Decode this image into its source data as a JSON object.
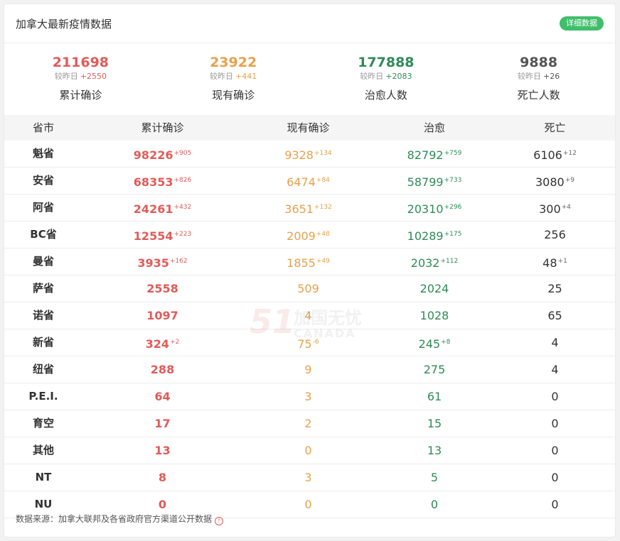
{
  "header": {
    "title": "加拿大最新疫情数据",
    "detail_button": "详细数据"
  },
  "summary": [
    {
      "value": "211698",
      "delta_label": "较昨日",
      "delta": "+2550",
      "label": "累计确诊",
      "color": "#e15b58"
    },
    {
      "value": "23922",
      "delta_label": "较昨日",
      "delta": "+441",
      "label": "现有确诊",
      "color": "#e9a04b"
    },
    {
      "value": "177888",
      "delta_label": "较昨日",
      "delta": "+2083",
      "label": "治愈人数",
      "color": "#2e8b57"
    },
    {
      "value": "9888",
      "delta_label": "较昨日",
      "delta": "+26",
      "label": "死亡人数",
      "color": "#555555"
    }
  ],
  "table": {
    "headers": {
      "province": "省市",
      "cumulative": "累计确诊",
      "active": "现有确诊",
      "recovered": "治愈",
      "deaths": "死亡"
    },
    "rows": [
      {
        "province": "魁省",
        "cumulative": "98226",
        "cumulative_inc": "+905",
        "active": "9328",
        "active_inc": "+134",
        "recovered": "82792",
        "recovered_inc": "+759",
        "deaths": "6106",
        "deaths_inc": "+12"
      },
      {
        "province": "安省",
        "cumulative": "68353",
        "cumulative_inc": "+826",
        "active": "6474",
        "active_inc": "+84",
        "recovered": "58799",
        "recovered_inc": "+733",
        "deaths": "3080",
        "deaths_inc": "+9"
      },
      {
        "province": "阿省",
        "cumulative": "24261",
        "cumulative_inc": "+432",
        "active": "3651",
        "active_inc": "+132",
        "recovered": "20310",
        "recovered_inc": "+296",
        "deaths": "300",
        "deaths_inc": "+4"
      },
      {
        "province": "BC省",
        "cumulative": "12554",
        "cumulative_inc": "+223",
        "active": "2009",
        "active_inc": "+48",
        "recovered": "10289",
        "recovered_inc": "+175",
        "deaths": "256",
        "deaths_inc": ""
      },
      {
        "province": "曼省",
        "cumulative": "3935",
        "cumulative_inc": "+162",
        "active": "1855",
        "active_inc": "+49",
        "recovered": "2032",
        "recovered_inc": "+112",
        "deaths": "48",
        "deaths_inc": "+1"
      },
      {
        "province": "萨省",
        "cumulative": "2558",
        "cumulative_inc": "",
        "active": "509",
        "active_inc": "",
        "recovered": "2024",
        "recovered_inc": "",
        "deaths": "25",
        "deaths_inc": ""
      },
      {
        "province": "诺省",
        "cumulative": "1097",
        "cumulative_inc": "",
        "active": "4",
        "active_inc": "",
        "recovered": "1028",
        "recovered_inc": "",
        "deaths": "65",
        "deaths_inc": ""
      },
      {
        "province": "新省",
        "cumulative": "324",
        "cumulative_inc": "+2",
        "active": "75",
        "active_inc": "-6",
        "recovered": "245",
        "recovered_inc": "+8",
        "deaths": "4",
        "deaths_inc": ""
      },
      {
        "province": "纽省",
        "cumulative": "288",
        "cumulative_inc": "",
        "active": "9",
        "active_inc": "",
        "recovered": "275",
        "recovered_inc": "",
        "deaths": "4",
        "deaths_inc": ""
      },
      {
        "province": "P.E.I.",
        "cumulative": "64",
        "cumulative_inc": "",
        "active": "3",
        "active_inc": "",
        "recovered": "61",
        "recovered_inc": "",
        "deaths": "0",
        "deaths_inc": ""
      },
      {
        "province": "育空",
        "cumulative": "17",
        "cumulative_inc": "",
        "active": "2",
        "active_inc": "",
        "recovered": "15",
        "recovered_inc": "",
        "deaths": "0",
        "deaths_inc": ""
      },
      {
        "province": "其他",
        "cumulative": "13",
        "cumulative_inc": "",
        "active": "0",
        "active_inc": "",
        "recovered": "13",
        "recovered_inc": "",
        "deaths": "0",
        "deaths_inc": ""
      },
      {
        "province": "NT",
        "cumulative": "8",
        "cumulative_inc": "",
        "active": "3",
        "active_inc": "",
        "recovered": "5",
        "recovered_inc": "",
        "deaths": "0",
        "deaths_inc": ""
      },
      {
        "province": "NU",
        "cumulative": "0",
        "cumulative_inc": "",
        "active": "0",
        "active_inc": "",
        "recovered": "0",
        "recovered_inc": "",
        "deaths": "0",
        "deaths_inc": ""
      }
    ]
  },
  "footer": {
    "source": "数据来源：加拿大联邦及各省政府官方渠道公开数据"
  },
  "watermark": {
    "big": "51",
    "cn": "加国无忧",
    "en": "CANADA"
  }
}
